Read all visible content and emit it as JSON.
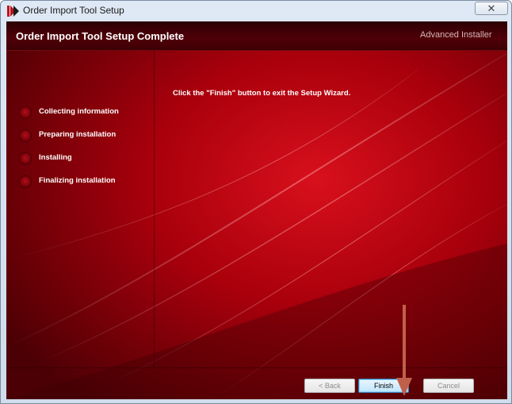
{
  "window": {
    "title": "Order Import Tool Setup",
    "close_label": "✕"
  },
  "header": {
    "title": "Order Import Tool Setup Complete",
    "brand": "Advanced Installer"
  },
  "steps": [
    {
      "label": "Collecting information"
    },
    {
      "label": "Preparing installation"
    },
    {
      "label": "Installing"
    },
    {
      "label": "Finalizing installation"
    }
  ],
  "main": {
    "message": "Click the \"Finish\" button to exit the Setup Wizard."
  },
  "buttons": {
    "back": "< Back",
    "finish": "Finish",
    "cancel": "Cancel"
  },
  "colors": {
    "accent_red": "#7a0006",
    "arrow": "#c0604a"
  },
  "icons": {
    "app": "advanced-installer-logo-icon",
    "close": "close-icon",
    "step": "step-bullet-icon",
    "annotation": "arrow-down-icon"
  }
}
